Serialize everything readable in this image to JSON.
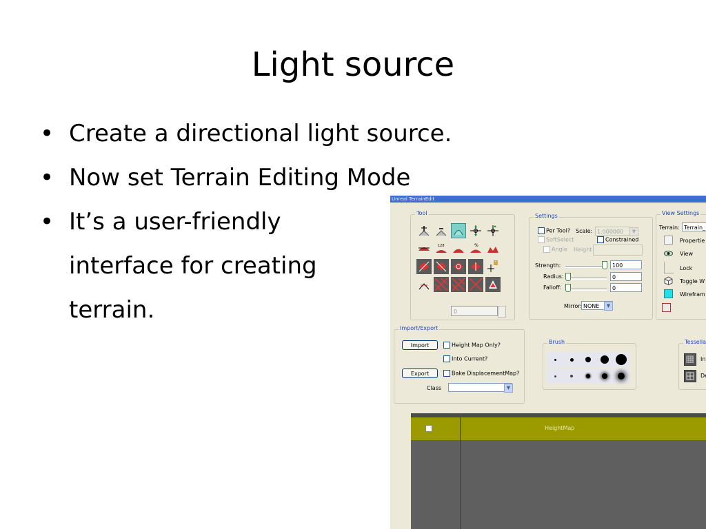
{
  "slide": {
    "title": "Light source",
    "bullets": [
      {
        "text": "Create a directional light source."
      },
      {
        "text": "Now set Terrain Editing Mode"
      },
      {
        "lines": [
          "It’s a user-friendly",
          "interface for creating",
          "terrain."
        ]
      }
    ]
  },
  "editor": {
    "window_title": "Unreal TerrainEdit",
    "tool_group": {
      "legend": "Tool",
      "counter_value": "0",
      "icons": [
        [
          "raise-icon",
          "lower-icon",
          "smooth-icon",
          "move-icon",
          "scale-icon"
        ],
        [
          "flatten-icon",
          "flatten-128-icon",
          "noise-icon",
          "percent-icon",
          "erode-icon"
        ],
        [
          "paint-red-icon",
          "paint-red-icon",
          "paint-red-icon",
          "paint-red-icon",
          "lock-move-icon"
        ],
        [
          "cross-icon",
          "hatch-icon",
          "hatch-icon",
          "hatch-icon",
          "decal-icon"
        ]
      ],
      "icon_labels": {
        "flatten_128": "128",
        "percent": "%"
      }
    },
    "settings_group": {
      "legend": "Settings",
      "per_tool_label": "Per Tool?",
      "scale_label": "Scale:",
      "scale_value": "1.000000",
      "softselect_label": "SoftSelect",
      "constrained_label": "Constrained",
      "angle_label": "Angle",
      "height_label": "Height",
      "strength_label": "Strength:",
      "strength_value": "100",
      "radius_label": "Radius:",
      "radius_value": "0",
      "falloff_label": "Falloff:",
      "falloff_value": "0",
      "mirror_label": "Mirror:",
      "mirror_value": "NONE"
    },
    "view_settings_group": {
      "legend": "View Settings",
      "terrain_label": "Terrain:",
      "terrain_value": "Terrain_",
      "items": [
        "Propertie",
        "View",
        "Lock",
        "Toggle W",
        "Wirefram"
      ]
    },
    "import_export_group": {
      "legend": "Import/Export",
      "import_label": "Import",
      "height_map_only_label": "Height Map Only?",
      "into_current_label": "Into Current?",
      "export_label": "Export",
      "bake_label": "Bake DisplacementMap?",
      "class_label": "Class",
      "class_value": ""
    },
    "brush_group": {
      "legend": "Brush",
      "hard_sizes": [
        3,
        5,
        8,
        12,
        16
      ],
      "soft_sizes": [
        2,
        3,
        5,
        9,
        13
      ]
    },
    "tessellation_group": {
      "legend": "Tessellat",
      "items": [
        "In",
        "De"
      ]
    },
    "heightmap_panel": {
      "column_label": "HeightMap"
    },
    "colors": {
      "window_bg": "#ece9d8",
      "legend_text": "#1b47c8",
      "heightmap_header": "#9b9b00",
      "heightmap_body": "#5f5f5f",
      "titlebar": "#3d6ed0"
    }
  }
}
